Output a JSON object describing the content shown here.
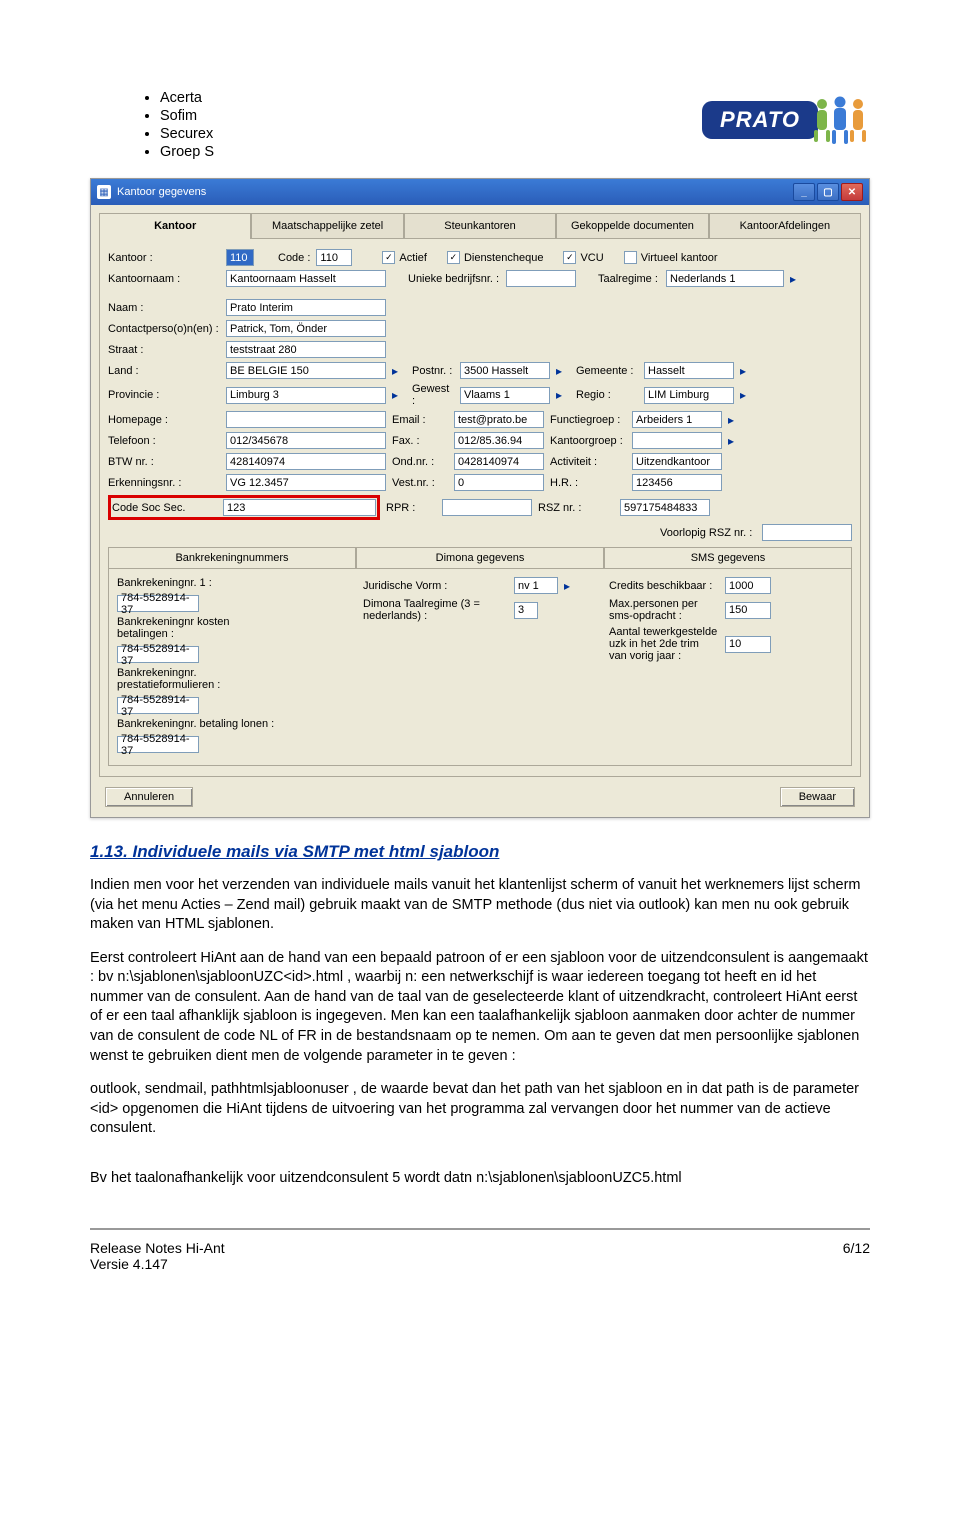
{
  "logo_text": "PRATO",
  "bullets": [
    "Acerta",
    "Sofim",
    "Securex",
    "Groep S"
  ],
  "screenshot": {
    "title": "Kantoor gegevens",
    "tabs": [
      "Kantoor",
      "Maatschappelijke zetel",
      "Steunkantoren",
      "Gekoppelde documenten",
      "KantoorAfdelingen"
    ],
    "fields": {
      "kantoor_lbl": "Kantoor :",
      "kantoor_val": "110",
      "code_lbl": "Code :",
      "code_val": "110",
      "chk_actief": "Actief",
      "chk_dienst": "Dienstencheque",
      "chk_vcu": "VCU",
      "chk_virt": "Virtueel kantoor",
      "kantoornaam_lbl": "Kantoornaam :",
      "kantoornaam_val": "Kantoornaam Hasselt",
      "unieke_lbl": "Unieke bedrijfsnr. :",
      "unieke_val": "",
      "taalregime_lbl": "Taalregime :",
      "taalregime_val": "Nederlands 1",
      "naam_lbl": "Naam :",
      "naam_val": "Prato Interim",
      "contact_lbl": "Contactperso(o)n(en) :",
      "contact_val": "Patrick, Tom, Önder",
      "straat_lbl": "Straat :",
      "straat_val": "teststraat 280",
      "land_lbl": "Land :",
      "land_val": "BE  BELGIE 150",
      "postnr_lbl": "Postnr. :",
      "postnr_val": "3500 Hasselt",
      "gemeente_lbl": "Gemeente :",
      "gemeente_val": "Hasselt",
      "provincie_lbl": "Provincie :",
      "provincie_val": "Limburg 3",
      "gewest_lbl": "Gewest :",
      "gewest_val": "Vlaams 1",
      "regio_lbl": "Regio :",
      "regio_val": "LIM Limburg",
      "homepage_lbl": "Homepage :",
      "homepage_val": "",
      "email_lbl": "Email :",
      "email_val": "test@prato.be",
      "functiegroep_lbl": "Functiegroep :",
      "functiegroep_val": "Arbeiders 1",
      "telefoon_lbl": "Telefoon :",
      "telefoon_val": "012/345678",
      "fax_lbl": "Fax. :",
      "fax_val": "012/85.36.94",
      "kantoorgroep_lbl": "Kantoorgroep :",
      "kantoorgroep_val": "",
      "btw_lbl": "BTW nr. :",
      "btw_val": "428140974",
      "ondnr_lbl": "Ond.nr. :",
      "ondnr_val": "0428140974",
      "activiteit_lbl": "Activiteit :",
      "activiteit_val": "Uitzendkantoor",
      "erkenning_lbl": "Erkenningsnr. :",
      "erkenning_val": "VG 12.3457",
      "vestnr_lbl": "Vest.nr. :",
      "vestnr_val": "0",
      "hr_lbl": "H.R. :",
      "hr_val": "123456",
      "codesoc_lbl": "Code Soc Sec.",
      "codesoc_val": "123",
      "rpr_lbl": "RPR :",
      "rpr_val": "",
      "rsz_lbl": "RSZ nr. :",
      "rsz_val": "597175484833",
      "voorlopig_lbl": "Voorlopig RSZ nr. :",
      "voorlopig_val": ""
    },
    "subtabs": [
      "Bankrekeningnummers",
      "Dimona gegevens",
      "SMS gegevens"
    ],
    "sub": {
      "bank1_lbl": "Bankrekeningnr. 1 :",
      "bank1_val": "784-5528914-37",
      "bank2_lbl": "Bankrekeningnr kosten betalingen :",
      "bank2_val": "784-5528914-37",
      "bank3_lbl": "Bankrekeningnr. prestatieformulieren :",
      "bank3_val": "784-5528914-37",
      "bank4_lbl": "Bankrekeningnr. betaling lonen :",
      "bank4_val": "784-5528914-37",
      "jurvorm_lbl": "Juridische Vorm :",
      "jurvorm_val": "nv 1",
      "dimona_lbl": "Dimona Taalregime (3 = nederlands) :",
      "dimona_val": "3",
      "credits_lbl": "Credits beschikbaar :",
      "credits_val": "1000",
      "maxp_lbl": "Max.personen per sms-opdracht :",
      "maxp_val": "150",
      "aantal_lbl": "Aantal tewerkgestelde uzk in het 2de trim van vorig jaar :",
      "aantal_val": "10"
    },
    "btn_annul": "Annuleren",
    "btn_bewaar": "Bewaar"
  },
  "section_number": "1.13.",
  "section_title": "Individuele mails via SMTP met html sjabloon",
  "p1": "Indien men voor het verzenden van individuele mails vanuit het klantenlijst scherm of vanuit het werknemers lijst scherm (via het menu Acties – Zend mail) gebruik maakt van de SMTP methode (dus niet via outlook) kan men nu ook gebruik maken van HTML sjablonen.",
  "p2": "Eerst controleert HiAnt aan de hand van een bepaald patroon of er een sjabloon voor de uitzendconsulent is aangemaakt : bv n:\\sjablonen\\sjabloonUZC<id>.html , waarbij n: een netwerkschijf is waar iedereen toegang tot heeft en id het nummer van de consulent.  Aan de hand van de taal van de geselecteerde klant of uitzendkracht, controleert HiAnt eerst of er een taal afhanklijk sjabloon is ingegeven. Men kan een taalafhankelijk sjabloon aanmaken door achter de nummer van de consulent de code NL of FR in de bestandsnaam op te nemen. Om aan te geven dat men persoonlijke sjablonen wenst te gebruiken dient men de volgende parameter in te geven :",
  "p3": "outlook, sendmail, pathhtmlsjabloonuser  , de waarde bevat dan het path van het sjabloon en in dat path is de parameter <id> opgenomen die HiAnt tijdens de uitvoering van het programma zal vervangen door het nummer van de actieve consulent.",
  "p4": "Bv het taalonafhankelijk voor uitzendconsulent 5 wordt datn n:\\sjablonen\\sjabloonUZC5.html",
  "footer": {
    "left1": "Release Notes Hi-Ant",
    "left2": "Versie 4.147",
    "right": "6/12"
  }
}
